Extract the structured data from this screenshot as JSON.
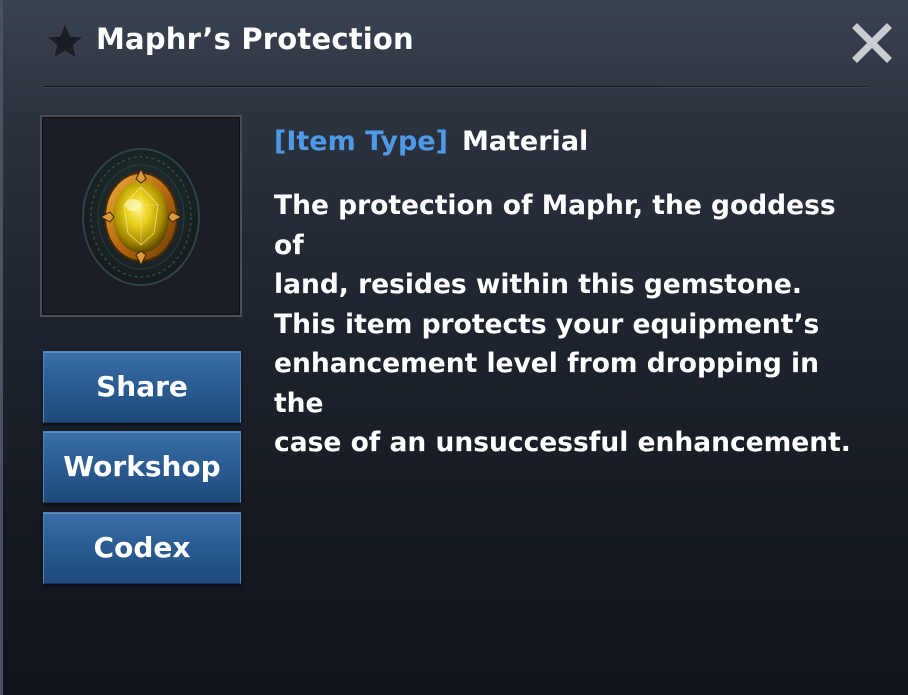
{
  "dialog": {
    "title": "Maphr’s Protection",
    "title_icon": "star-icon",
    "close_icon": "close-icon"
  },
  "item": {
    "icon": "yellow-gemstone-icon",
    "type_label": "[Item Type]",
    "type_value": "Material",
    "description_lines": [
      "The protection of Maphr, the goddess of",
      "land, resides within this gemstone.",
      "This item protects your equipment’s",
      "enhancement level from dropping in the",
      "case of an unsuccessful enhancement."
    ]
  },
  "buttons": {
    "share": "Share",
    "workshop": "Workshop",
    "codex": "Codex"
  },
  "colors": {
    "item_type_label": "#4f9ae8",
    "button_blue": "#2b5d94",
    "gem_yellow": "#e8d01a",
    "panel_dark": "#1f252f"
  }
}
